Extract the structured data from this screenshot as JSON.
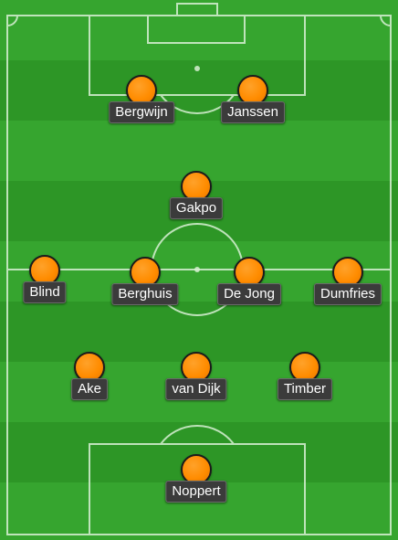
{
  "pitch": {
    "colors": {
      "grass_light": "#36a52f",
      "grass_dark": "#2d9626",
      "lines": "#d8f0d4",
      "shirt": "#ff8c00"
    }
  },
  "players": [
    {
      "name": "Bergwijn"
    },
    {
      "name": "Janssen"
    },
    {
      "name": "Gakpo"
    },
    {
      "name": "Blind"
    },
    {
      "name": "Berghuis"
    },
    {
      "name": "De Jong"
    },
    {
      "name": "Dumfries"
    },
    {
      "name": "Ake"
    },
    {
      "name": "van Dijk"
    },
    {
      "name": "Timber"
    },
    {
      "name": "Noppert"
    }
  ]
}
